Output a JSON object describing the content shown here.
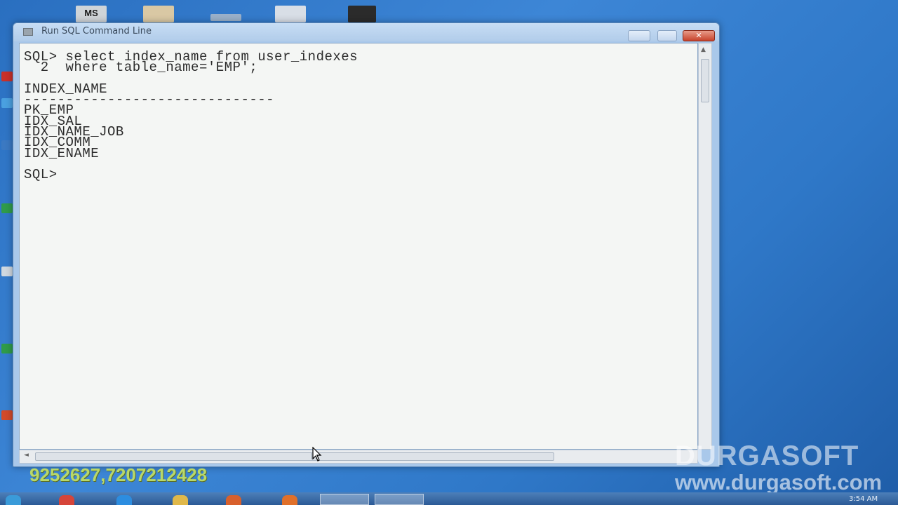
{
  "window": {
    "title": "Run SQL Command Line",
    "controls": {
      "minimize": "",
      "maximize": "",
      "close": "✕"
    }
  },
  "console": {
    "lines": [
      "SQL> select index_name from user_indexes",
      "  2  where table_name='EMP';",
      "",
      "INDEX_NAME",
      "------------------------------",
      "PK_EMP",
      "IDX_SAL",
      "IDX_NAME_JOB",
      "IDX_COMM",
      "IDX_ENAME",
      "",
      "SQL>"
    ]
  },
  "watermark": {
    "phone": "9252627,7207212428",
    "brand": "DURGASOFT",
    "website": "www.durgasoft.com"
  },
  "desktop": {
    "ms_icon_label": "MS"
  },
  "taskbar": {
    "clock": "3:54 AM"
  },
  "colors": {
    "desktop_bg": "#3d86d6",
    "console_bg": "#f4f6f4",
    "console_text": "#2b2b2b",
    "close_button": "#c7432c"
  }
}
